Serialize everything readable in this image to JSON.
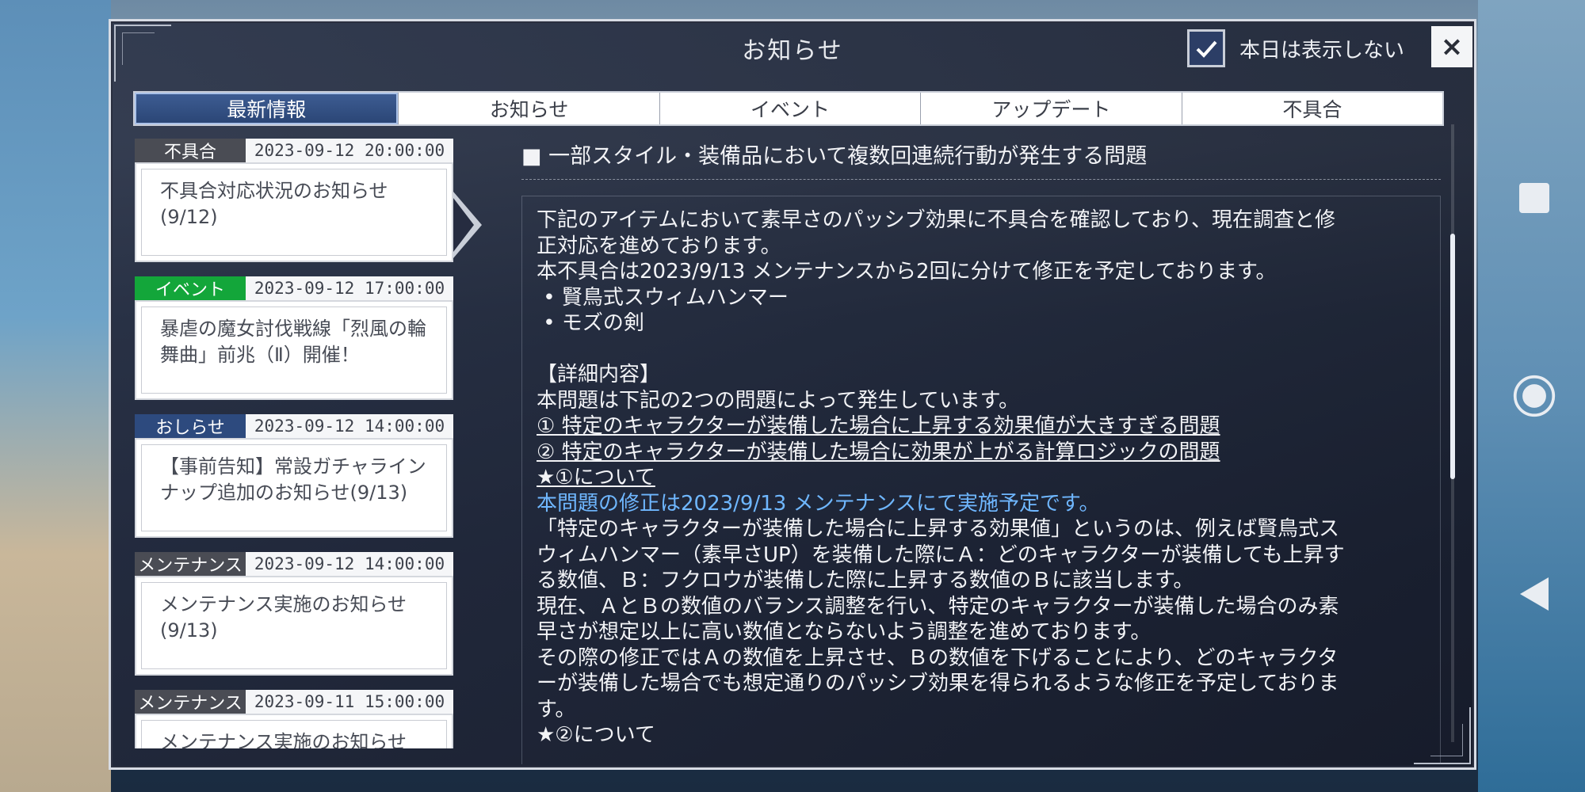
{
  "dialog": {
    "title": "お知らせ",
    "hide_today_label": "本日は表示しない",
    "hide_today_checked": true,
    "close_label": "×"
  },
  "tabs": [
    {
      "label": "最新情報",
      "active": true
    },
    {
      "label": "お知らせ",
      "active": false
    },
    {
      "label": "イベント",
      "active": false
    },
    {
      "label": "アップデート",
      "active": false
    },
    {
      "label": "不具合",
      "active": false
    }
  ],
  "news": [
    {
      "category": "不具合",
      "color": "#4a4c54",
      "date": "2023-09-12 20:00:00",
      "title_lines": [
        "不具合対応状況のお知らせ",
        "(9/12)"
      ]
    },
    {
      "category": "イベント",
      "color": "#13a63a",
      "date": "2023-09-12 17:00:00",
      "title_lines": [
        "暴虐の魔女討伐戦線「烈風の輪",
        "舞曲」前兆（Ⅱ）開催！"
      ]
    },
    {
      "category": "おしらせ",
      "color": "#2d4a7e",
      "date": "2023-09-12 14:00:00",
      "title_lines": [
        "【事前告知】常設ガチャライン",
        "ナップ追加のお知らせ(9/13)"
      ]
    },
    {
      "category": "メンテナンス",
      "color": "#4a4c54",
      "date": "2023-09-12 14:00:00",
      "title_lines": [
        "メンテナンス実施のお知らせ",
        "(9/13)"
      ]
    },
    {
      "category": "メンテナンス",
      "color": "#4a4c54",
      "date": "2023-09-11 15:00:00",
      "title_lines": [
        "メンテナンス実施のお知らせ",
        ""
      ]
    }
  ],
  "article": {
    "heading": "■  一部スタイル・装備品において複数回連続行動が発生する問題",
    "lines": [
      {
        "text": "下記のアイテムにおいて素早さのパッシブ効果に不具合を確認しており、現在調査と修",
        "style": ""
      },
      {
        "text": "正対応を進めております。",
        "style": ""
      },
      {
        "text": "本不具合は2023/9/13 メンテナンスから2回に分けて修正を予定しております。",
        "style": ""
      },
      {
        "text": " • 賢鳥式スウィムハンマー",
        "style": ""
      },
      {
        "text": " • モズの剣",
        "style": ""
      },
      {
        "text": " ",
        "style": ""
      },
      {
        "text": "【詳細内容】",
        "style": ""
      },
      {
        "text": "本問題は下記の2つの問題によって発生しています。",
        "style": ""
      },
      {
        "text": "① 特定のキャラクターが装備した場合に上昇する効果値が大きすぎる問題",
        "style": "u"
      },
      {
        "text": "② 特定のキャラクターが装備した場合に効果が上がる計算ロジックの問題",
        "style": "u"
      },
      {
        "text": "★①について",
        "style": "u"
      },
      {
        "text": "本問題の修正は2023/9/13 メンテナンスにて実施予定です。",
        "style": "blue"
      },
      {
        "text": "「特定のキャラクターが装備した場合に上昇する効果値」というのは、例えば賢鳥式ス",
        "style": ""
      },
      {
        "text": "ウィムハンマー（素早さUP）を装備した際にＡ：どのキャラクターが装備しても上昇す",
        "style": ""
      },
      {
        "text": "る数値、Ｂ：フクロウが装備した際に上昇する数値のＢに該当します。",
        "style": ""
      },
      {
        "text": "現在、ＡとＢの数値のバランス調整を行い、特定のキャラクターが装備した場合のみ素",
        "style": ""
      },
      {
        "text": "早さが想定以上に高い数値とならないよう調整を進めております。",
        "style": ""
      },
      {
        "text": "その際の修正ではＡの数値を上昇させ、Ｂの数値を下げることにより、どのキャラクタ",
        "style": ""
      },
      {
        "text": "ーが装備した場合でも想定通りのパッシブ効果を得られるような修正を予定しておりま",
        "style": ""
      },
      {
        "text": "す。",
        "style": ""
      },
      {
        "text": "★②について",
        "style": ""
      }
    ]
  },
  "nav": {
    "icons": [
      "square-icon",
      "home-circle-icon",
      "back-triangle-icon"
    ]
  }
}
